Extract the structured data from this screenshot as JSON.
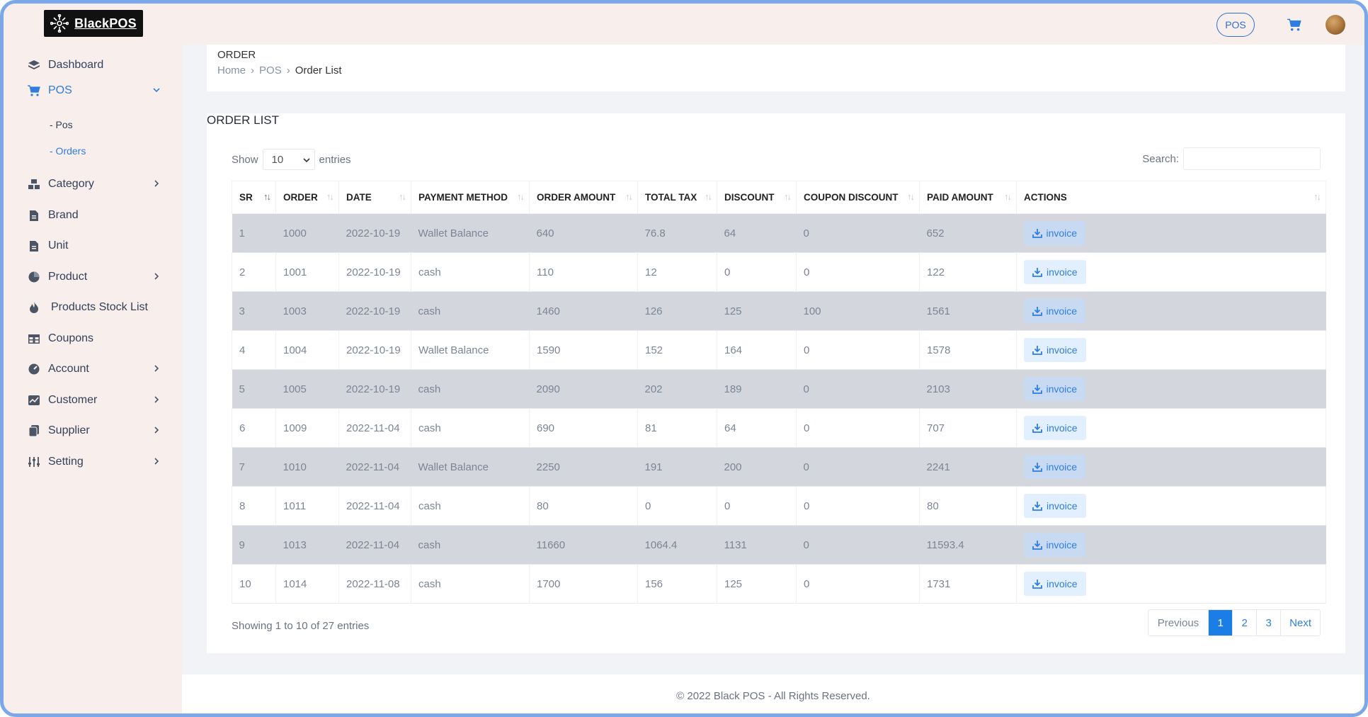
{
  "brand": {
    "name": "BlackPOS"
  },
  "sidebar": {
    "items": [
      {
        "label": "Dashboard",
        "icon": "layers-icon"
      },
      {
        "label": "POS",
        "icon": "cart-icon"
      },
      {
        "label": "Category",
        "icon": "category-icon"
      },
      {
        "label": "Brand",
        "icon": "file-icon"
      },
      {
        "label": "Unit",
        "icon": "file-icon"
      },
      {
        "label": "Product",
        "icon": "pie-icon"
      },
      {
        "label": "Products Stock List",
        "icon": "fire-icon"
      },
      {
        "label": "Coupons",
        "icon": "table-icon"
      },
      {
        "label": "Account",
        "icon": "gauge-icon"
      },
      {
        "label": "Customer",
        "icon": "chart-icon"
      },
      {
        "label": "Supplier",
        "icon": "copy-icon"
      },
      {
        "label": "Setting",
        "icon": "sliders-icon"
      }
    ],
    "pos_sub": [
      {
        "label": "- Pos"
      },
      {
        "label": "- Orders"
      }
    ]
  },
  "topbar": {
    "pos_button": "POS"
  },
  "breadcrumb": {
    "title": "ORDER",
    "home": "Home",
    "pos": "POS",
    "current": "Order List"
  },
  "card": {
    "title": "ORDER LIST",
    "show_label": "Show",
    "entries_value": "10",
    "entries_label": "entries",
    "search_label": "Search:",
    "search_value": ""
  },
  "table": {
    "headers": [
      "SR",
      "ORDER",
      "DATE",
      "PAYMENT METHOD",
      "ORDER AMOUNT",
      "TOTAL TAX",
      "DISCOUNT",
      "COUPON DISCOUNT",
      "PAID AMOUNT",
      "ACTIONS"
    ],
    "action_label": "invoice",
    "rows": [
      [
        "1",
        "1000",
        "2022-10-19",
        "Wallet Balance",
        "640",
        "76.8",
        "64",
        "0",
        "652"
      ],
      [
        "2",
        "1001",
        "2022-10-19",
        "cash",
        "110",
        "12",
        "0",
        "0",
        "122"
      ],
      [
        "3",
        "1003",
        "2022-10-19",
        "cash",
        "1460",
        "126",
        "125",
        "100",
        "1561"
      ],
      [
        "4",
        "1004",
        "2022-10-19",
        "Wallet Balance",
        "1590",
        "152",
        "164",
        "0",
        "1578"
      ],
      [
        "5",
        "1005",
        "2022-10-19",
        "cash",
        "2090",
        "202",
        "189",
        "0",
        "2103"
      ],
      [
        "6",
        "1009",
        "2022-11-04",
        "cash",
        "690",
        "81",
        "64",
        "0",
        "707"
      ],
      [
        "7",
        "1010",
        "2022-11-04",
        "Wallet Balance",
        "2250",
        "191",
        "200",
        "0",
        "2241"
      ],
      [
        "8",
        "1011",
        "2022-11-04",
        "cash",
        "80",
        "0",
        "0",
        "0",
        "80"
      ],
      [
        "9",
        "1013",
        "2022-11-04",
        "cash",
        "11660",
        "1064.4",
        "1131",
        "0",
        "11593.4"
      ],
      [
        "10",
        "1014",
        "2022-11-08",
        "cash",
        "1700",
        "156",
        "125",
        "0",
        "1731"
      ]
    ]
  },
  "pagination": {
    "info": "Showing 1 to 10 of 27 entries",
    "previous": "Previous",
    "pages": [
      "1",
      "2",
      "3"
    ],
    "next": "Next"
  },
  "footer": {
    "copyright": "© 2022 Black POS - All Rights Reserved."
  },
  "colors": {
    "accent": "#2f7de1",
    "sidebar_bg": "#f8eeec",
    "striped_row": "#d3d6dd"
  }
}
